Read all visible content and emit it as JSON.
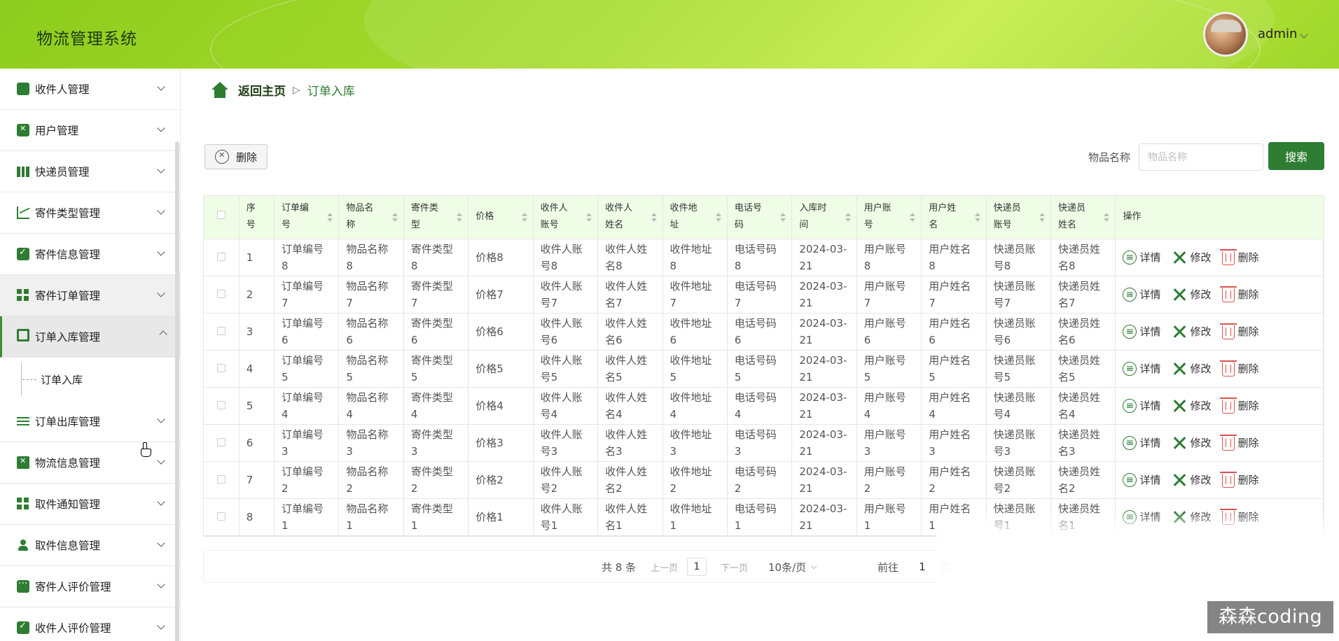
{
  "header": {
    "app_title": "物流管理系统",
    "username": "admin",
    "avatar_icon": "user-avatar-icon"
  },
  "sidebar": {
    "items": [
      {
        "label": "收件人管理",
        "icon": "briefcase-icon"
      },
      {
        "label": "用户管理",
        "icon": "clipboard-x-icon"
      },
      {
        "label": "快递员管理",
        "icon": "books-icon"
      },
      {
        "label": "寄件类型管理",
        "icon": "chart-line-icon"
      },
      {
        "label": "寄件信息管理",
        "icon": "clipboard-check-icon"
      },
      {
        "label": "寄件订单管理",
        "icon": "grid-icon"
      },
      {
        "label": "订单入库管理",
        "icon": "monitor-icon",
        "expanded": true
      },
      {
        "label": "订单出库管理",
        "icon": "sliders-icon"
      },
      {
        "label": "物流信息管理",
        "icon": "truck-icon"
      },
      {
        "label": "取件通知管理",
        "icon": "grid-icon"
      },
      {
        "label": "取件信息管理",
        "icon": "person-icon"
      },
      {
        "label": "寄件人评价管理",
        "icon": "chat-icon"
      },
      {
        "label": "收件人评价管理",
        "icon": "clipboard-check-icon"
      }
    ],
    "submenu": {
      "label": "订单入库"
    }
  },
  "breadcrumb": {
    "home": "返回主页",
    "separator": "▷",
    "current": "订单入库"
  },
  "toolbar": {
    "delete_label": "删除",
    "search_label": "物品名称",
    "search_placeholder": "物品名称",
    "search_button": "搜索"
  },
  "table": {
    "headers": [
      "序号",
      "订单编号",
      "物品名称",
      "寄件类型",
      "价格",
      "收件人账号",
      "收件人姓名",
      "收件地址",
      "电话号码",
      "入库时间",
      "用户账号",
      "用户姓名",
      "快递员账号",
      "快递员姓名",
      "操作"
    ],
    "header_lines": [
      [
        "序号"
      ],
      [
        "订单编",
        "号"
      ],
      [
        "物品名",
        "称"
      ],
      [
        "寄件类",
        "型"
      ],
      [
        "价格"
      ],
      [
        "收件人",
        "账号"
      ],
      [
        "收件人",
        "姓名"
      ],
      [
        "收件地",
        "址"
      ],
      [
        "电话号",
        "码"
      ],
      [
        "入库时",
        "间"
      ],
      [
        "用户账",
        "号"
      ],
      [
        "用户姓",
        "名"
      ],
      [
        "快递员",
        "账号"
      ],
      [
        "快递员",
        "姓名"
      ],
      [
        "操作"
      ]
    ],
    "ops": {
      "detail": "详情",
      "edit": "修改",
      "delete": "删除"
    },
    "rows": [
      {
        "seq": "1",
        "cells": [
          [
            "订单编号",
            "8"
          ],
          [
            "物品名称",
            "8"
          ],
          [
            "寄件类型",
            "8"
          ],
          [
            "价格8"
          ],
          [
            "收件人账",
            "号8"
          ],
          [
            "收件人姓",
            "名8"
          ],
          [
            "收件地址",
            "8"
          ],
          [
            "电话号码",
            "8"
          ],
          [
            "2024-03-",
            "21"
          ],
          [
            "用户账号",
            "8"
          ],
          [
            "用户姓名",
            "8"
          ],
          [
            "快递员账",
            "号8"
          ],
          [
            "快递员姓",
            "名8"
          ]
        ]
      },
      {
        "seq": "2",
        "cells": [
          [
            "订单编号",
            "7"
          ],
          [
            "物品名称",
            "7"
          ],
          [
            "寄件类型",
            "7"
          ],
          [
            "价格7"
          ],
          [
            "收件人账",
            "号7"
          ],
          [
            "收件人姓",
            "名7"
          ],
          [
            "收件地址",
            "7"
          ],
          [
            "电话号码",
            "7"
          ],
          [
            "2024-03-",
            "21"
          ],
          [
            "用户账号",
            "7"
          ],
          [
            "用户姓名",
            "7"
          ],
          [
            "快递员账",
            "号7"
          ],
          [
            "快递员姓",
            "名7"
          ]
        ]
      },
      {
        "seq": "3",
        "cells": [
          [
            "订单编号",
            "6"
          ],
          [
            "物品名称",
            "6"
          ],
          [
            "寄件类型",
            "6"
          ],
          [
            "价格6"
          ],
          [
            "收件人账",
            "号6"
          ],
          [
            "收件人姓",
            "名6"
          ],
          [
            "收件地址",
            "6"
          ],
          [
            "电话号码",
            "6"
          ],
          [
            "2024-03-",
            "21"
          ],
          [
            "用户账号",
            "6"
          ],
          [
            "用户姓名",
            "6"
          ],
          [
            "快递员账",
            "号6"
          ],
          [
            "快递员姓",
            "名6"
          ]
        ]
      },
      {
        "seq": "4",
        "cells": [
          [
            "订单编号",
            "5"
          ],
          [
            "物品名称",
            "5"
          ],
          [
            "寄件类型",
            "5"
          ],
          [
            "价格5"
          ],
          [
            "收件人账",
            "号5"
          ],
          [
            "收件人姓",
            "名5"
          ],
          [
            "收件地址",
            "5"
          ],
          [
            "电话号码",
            "5"
          ],
          [
            "2024-03-",
            "21"
          ],
          [
            "用户账号",
            "5"
          ],
          [
            "用户姓名",
            "5"
          ],
          [
            "快递员账",
            "号5"
          ],
          [
            "快递员姓",
            "名5"
          ]
        ]
      },
      {
        "seq": "5",
        "cells": [
          [
            "订单编号",
            "4"
          ],
          [
            "物品名称",
            "4"
          ],
          [
            "寄件类型",
            "4"
          ],
          [
            "价格4"
          ],
          [
            "收件人账",
            "号4"
          ],
          [
            "收件人姓",
            "名4"
          ],
          [
            "收件地址",
            "4"
          ],
          [
            "电话号码",
            "4"
          ],
          [
            "2024-03-",
            "21"
          ],
          [
            "用户账号",
            "4"
          ],
          [
            "用户姓名",
            "4"
          ],
          [
            "快递员账",
            "号4"
          ],
          [
            "快递员姓",
            "名4"
          ]
        ]
      },
      {
        "seq": "6",
        "cells": [
          [
            "订单编号",
            "3"
          ],
          [
            "物品名称",
            "3"
          ],
          [
            "寄件类型",
            "3"
          ],
          [
            "价格3"
          ],
          [
            "收件人账",
            "号3"
          ],
          [
            "收件人姓",
            "名3"
          ],
          [
            "收件地址",
            "3"
          ],
          [
            "电话号码",
            "3"
          ],
          [
            "2024-03-",
            "21"
          ],
          [
            "用户账号",
            "3"
          ],
          [
            "用户姓名",
            "3"
          ],
          [
            "快递员账",
            "号3"
          ],
          [
            "快递员姓",
            "名3"
          ]
        ]
      },
      {
        "seq": "7",
        "cells": [
          [
            "订单编号",
            "2"
          ],
          [
            "物品名称",
            "2"
          ],
          [
            "寄件类型",
            "2"
          ],
          [
            "价格2"
          ],
          [
            "收件人账",
            "号2"
          ],
          [
            "收件人姓",
            "名2"
          ],
          [
            "收件地址",
            "2"
          ],
          [
            "电话号码",
            "2"
          ],
          [
            "2024-03-",
            "21"
          ],
          [
            "用户账号",
            "2"
          ],
          [
            "用户姓名",
            "2"
          ],
          [
            "快递员账",
            "号2"
          ],
          [
            "快递员姓",
            "名2"
          ]
        ]
      },
      {
        "seq": "8",
        "cells": [
          [
            "订单编号",
            "1"
          ],
          [
            "物品名称",
            "1"
          ],
          [
            "寄件类型",
            "1"
          ],
          [
            "价格1"
          ],
          [
            "收件人账",
            "号1"
          ],
          [
            "收件人姓",
            "名1"
          ],
          [
            "收件地址",
            "1"
          ],
          [
            "电话号码",
            "1"
          ],
          [
            "2024-03-",
            "21"
          ],
          [
            "用户账号",
            "1"
          ],
          [
            "用户姓名",
            "1"
          ],
          [
            "快递员账",
            "号1"
          ],
          [
            "快递员姓",
            "名1"
          ]
        ]
      }
    ]
  },
  "pagination": {
    "total": "共 8 条",
    "prev": "上一页",
    "current_page": "1",
    "next": "下一页",
    "page_size": "10条/页",
    "goto_label": "前往",
    "goto_value": "1",
    "goto_unit": "页"
  },
  "watermark": "森森coding",
  "colors": {
    "accent": "#2e7d32",
    "header_green": "#a7dc2e",
    "danger": "#d9534f"
  }
}
